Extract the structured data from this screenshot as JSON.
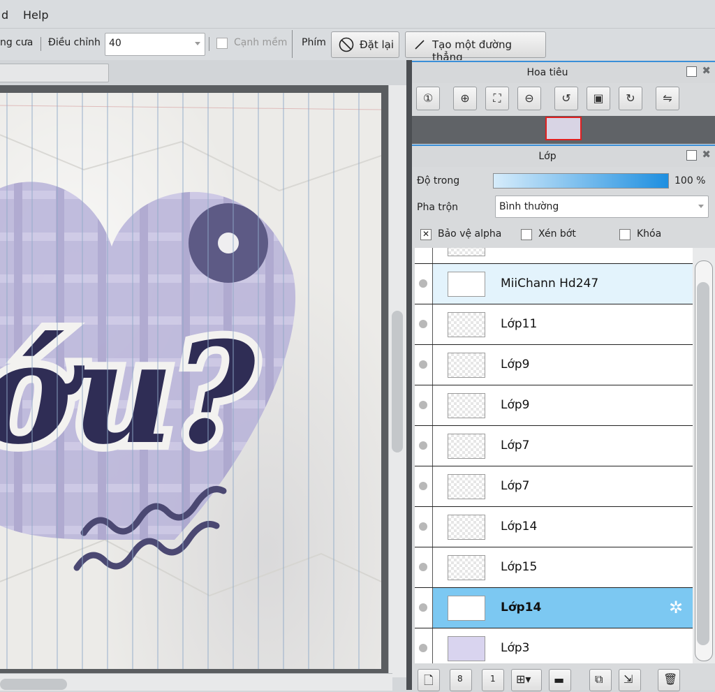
{
  "menu": {
    "items": [
      "d",
      "Help"
    ]
  },
  "toolbar": {
    "antialias_label": "ng cưa",
    "adjust_label": "Điều chỉnh",
    "adjust_value": "40",
    "smooth_label": "Cạnh mềm",
    "key_label": "Phím",
    "reset_button": "Đặt lại",
    "line_button": "Tạo một đường thẳng"
  },
  "navigator": {
    "title": "Hoa tiêu",
    "buttons": [
      "zoom-100-icon",
      "zoom-in-icon",
      "fit-icon",
      "zoom-out-icon",
      "rotate-left-icon",
      "fit-window-icon",
      "rotate-right-icon",
      "flip-icon"
    ]
  },
  "layers_panel": {
    "title": "Lớp",
    "opacity_label": "Độ trong",
    "opacity_value": "100 %",
    "opacity_fraction": 1.0,
    "blend_label": "Pha trộn",
    "blend_value": "Bình thường",
    "protect_alpha": "Bảo vệ alpha",
    "clip": "Xén bớt",
    "lock": "Khóa",
    "layers": [
      {
        "name": "MiiChann Hd247",
        "state": "highlight"
      },
      {
        "name": "Lớp11",
        "state": ""
      },
      {
        "name": "Lớp9",
        "state": ""
      },
      {
        "name": "Lớp9",
        "state": ""
      },
      {
        "name": "Lớp7",
        "state": ""
      },
      {
        "name": "Lớp7",
        "state": ""
      },
      {
        "name": "Lớp14",
        "state": ""
      },
      {
        "name": "Lớp15",
        "state": ""
      },
      {
        "name": "Lớp14",
        "state": "selected"
      },
      {
        "name": "Lớp3",
        "state": ""
      }
    ]
  },
  "colors": {
    "accent": "#3a8fd8",
    "selected_row": "#7cc8f2",
    "art_purple": "#b7b2d9",
    "art_navy": "#2f2d55"
  }
}
